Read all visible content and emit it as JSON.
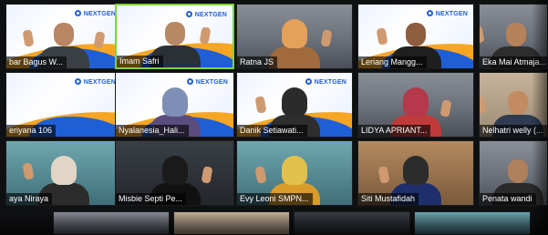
{
  "meeting": {
    "brand": {
      "logo_text": "NEXTGEN"
    },
    "participants": [
      {
        "name": "bar Bagus W..."
      },
      {
        "name": "Imam Safri"
      },
      {
        "name": "Ratna JS"
      },
      {
        "name": "Leriang Mangg..."
      },
      {
        "name": "Eka Mai Atmaja..."
      },
      {
        "name": "eriyana 106"
      },
      {
        "name": "Nyalanesia_Hali..."
      },
      {
        "name": "Danik Setiawati..."
      },
      {
        "name": "LIDYA APRIANT..."
      },
      {
        "name": "Nelhatri welly (..."
      },
      {
        "name": "aya Niraya"
      },
      {
        "name": "Misbie Septi Pe..."
      },
      {
        "name": "Evy Leoni SMPN..."
      },
      {
        "name": "Siti Mustafidah"
      },
      {
        "name": "Penata wandi"
      }
    ]
  }
}
